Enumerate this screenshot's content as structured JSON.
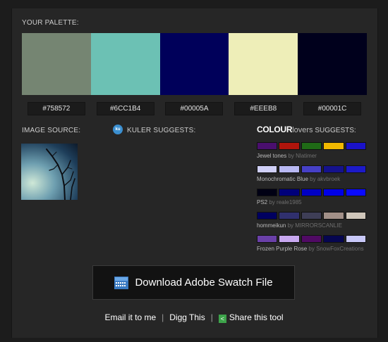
{
  "palette": {
    "heading": "YOUR PALETTE:",
    "colors": [
      {
        "hex": "#758572",
        "label": "#758572"
      },
      {
        "hex": "#6CC1B4",
        "label": "#6CC1B4"
      },
      {
        "hex": "#00005A",
        "label": "#00005A"
      },
      {
        "hex": "#EEEEB8",
        "label": "#EEEB8"
      },
      {
        "hex": "#00001C",
        "label": "#00001C"
      }
    ]
  },
  "image_source": {
    "heading": "IMAGE SOURCE:"
  },
  "kuler": {
    "icon": "kuler-icon",
    "heading": "KULER SUGGESTS:"
  },
  "colourlovers": {
    "brand": "COLOUR",
    "brand_suffix": "lovers",
    "heading_suffix": " SUGGESTS:",
    "suggestions": [
      {
        "name": "Jewel tones",
        "by": "by Nlatimer",
        "colors": [
          "#4a0f6e",
          "#b0150c",
          "#1f6a16",
          "#f0b800",
          "#1a12c8"
        ]
      },
      {
        "name": "Monochromatic Blue",
        "by": "by akvbroek",
        "colors": [
          "#d0d0f8",
          "#b8b8f2",
          "#4640c6",
          "#15128c",
          "#1c1ac8"
        ]
      },
      {
        "name": "PS2",
        "by": "by reale1985",
        "colors": [
          "#000014",
          "#00007a",
          "#0000c4",
          "#0000e8",
          "#0a0aff"
        ]
      },
      {
        "name": "hommeikun",
        "by": "by MIRRORSCANLIE",
        "colors": [
          "#000060",
          "#30306e",
          "#3e3e56",
          "#a29088",
          "#cfc6ba"
        ]
      },
      {
        "name": "Frozen Purple Rose",
        "by": "by SnowFoxCreations",
        "colors": [
          "#6a40a8",
          "#c8a8f0",
          "#500a64",
          "#060650",
          "#c8c8f8"
        ]
      }
    ]
  },
  "download": {
    "icon": "swatch-file-icon",
    "label": "Download Adobe Swatch File"
  },
  "links": {
    "email": "Email it to me",
    "separator": "|",
    "digg": "Digg This",
    "share_icon": "share-icon",
    "share": "Share this tool"
  }
}
